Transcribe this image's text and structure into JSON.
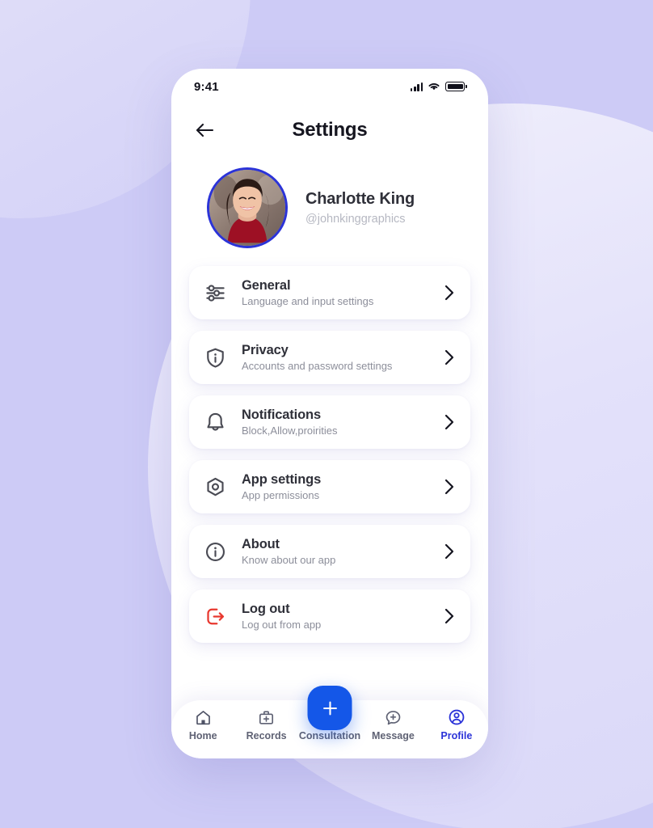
{
  "status_bar": {
    "time": "9:41",
    "signal_icon": "signal-bars-icon",
    "wifi_icon": "wifi-icon",
    "battery_icon": "battery-full-icon"
  },
  "header": {
    "back_icon": "arrow-left-icon",
    "title": "Settings"
  },
  "profile": {
    "name": "Charlotte King",
    "handle": "@johnkinggraphics",
    "avatar_icon": "user-avatar-photo",
    "ring_color": "#2b33d8"
  },
  "settings": {
    "items": [
      {
        "title": "General",
        "subtitle": "Language and input settings",
        "icon": "sliders-icon",
        "color": "#4a4b54"
      },
      {
        "title": "Privacy",
        "subtitle": "Accounts and password settings",
        "icon": "shield-info-icon",
        "color": "#4a4b54"
      },
      {
        "title": "Notifications",
        "subtitle": "Block,Allow,proirities",
        "icon": "bell-icon",
        "color": "#4a4b54"
      },
      {
        "title": "App settings",
        "subtitle": "App permissions",
        "icon": "hexagon-gear-icon",
        "color": "#4a4b54"
      },
      {
        "title": "About",
        "subtitle": "Know about our app",
        "icon": "info-circle-icon",
        "color": "#4a4b54"
      },
      {
        "title": "Log out",
        "subtitle": "Log out from app",
        "icon": "logout-icon",
        "color": "#e8382f"
      }
    ],
    "chevron_icon": "chevron-right-icon"
  },
  "fab": {
    "icon": "plus-icon",
    "color": "#1457e8"
  },
  "bottom_nav": {
    "active": "Profile",
    "items": [
      {
        "label": "Home",
        "icon": "home-icon"
      },
      {
        "label": "Records",
        "icon": "medical-bag-icon"
      },
      {
        "label": "Consultation",
        "icon": "consultation-icon"
      },
      {
        "label": "Message",
        "icon": "chat-plus-icon"
      },
      {
        "label": "Profile",
        "icon": "user-circle-icon"
      }
    ]
  },
  "theme": {
    "background": "#cdcbf6",
    "accent": "#2b33d8",
    "danger": "#e8382f"
  }
}
